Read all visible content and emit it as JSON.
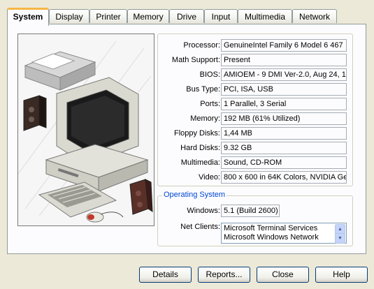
{
  "tabs": [
    "System",
    "Display",
    "Printer",
    "Memory",
    "Drive",
    "Input",
    "Multimedia",
    "Network"
  ],
  "active_tab": "System",
  "system_info": [
    {
      "label": "Processor:",
      "value": "GenuineIntel Family 6 Model 6 467"
    },
    {
      "label": "Math Support:",
      "value": "Present"
    },
    {
      "label": "BIOS:",
      "value": "AMIOEM - 9 DMI Ver-2.0, Aug 24, 1"
    },
    {
      "label": "Bus Type:",
      "value": "PCI, ISA, USB"
    },
    {
      "label": "Ports:",
      "value": "1 Parallel, 3 Serial"
    },
    {
      "label": "Memory:",
      "value": "192 MB  (61% Utilized)"
    },
    {
      "label": "Floppy Disks:",
      "value": "1,44 MB"
    },
    {
      "label": "Hard Disks:",
      "value": "9.32 GB"
    },
    {
      "label": "Multimedia:",
      "value": "Sound, CD-ROM"
    },
    {
      "label": "Video:",
      "value": "800 x 600 in 64K Colors, NVIDIA Ge"
    }
  ],
  "os_group": {
    "legend": "Operating System",
    "windows_label": "Windows:",
    "windows_value": "5.1 (Build 2600)",
    "net_clients_label": "Net Clients:",
    "net_clients": [
      "Microsoft Terminal Services",
      "Microsoft Windows Network"
    ]
  },
  "buttons": {
    "details": "Details",
    "reports": "Reports...",
    "close": "Close",
    "help": "Help"
  },
  "colors": {
    "face": "#ece9d8",
    "panel": "#fcfcfe",
    "tab_highlight": "#f7b646",
    "group_legend": "#0046d5"
  }
}
